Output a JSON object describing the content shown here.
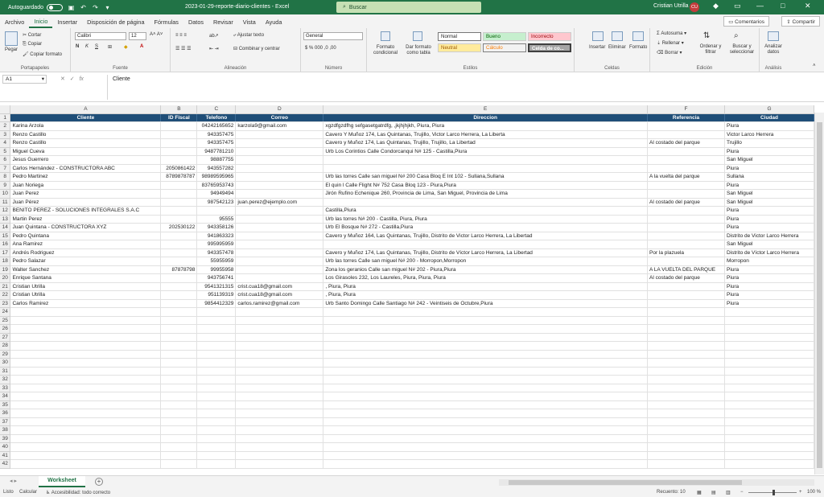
{
  "titlebar": {
    "autosave_label": "Autoguardado",
    "document_title": "2023-01-29-reporte-diario-clientes - Excel",
    "search_placeholder": "Buscar",
    "user_name": "Cristian Utrilla",
    "user_initials": "CU"
  },
  "menu": {
    "tabs": [
      "Archivo",
      "Inicio",
      "Insertar",
      "Disposición de página",
      "Fórmulas",
      "Datos",
      "Revisar",
      "Vista",
      "Ayuda"
    ],
    "active": "Inicio",
    "comments_label": "Comentarios",
    "share_label": "Compartir"
  },
  "ribbon": {
    "clipboard": {
      "paste": "Pegar",
      "cut": "Cortar",
      "copy": "Copiar",
      "format_painter": "Copiar formato",
      "label": "Portapapeles"
    },
    "font": {
      "name": "Calibri",
      "size": "12",
      "label": "Fuente"
    },
    "alignment": {
      "wrap": "Ajustar texto",
      "merge": "Combinar y centrar",
      "label": "Alineación"
    },
    "number": {
      "format": "General",
      "label": "Número"
    },
    "styles": {
      "conditional": "Formato condicional",
      "as_table": "Dar formato como tabla",
      "normal": "Normal",
      "good": "Bueno",
      "bad": "Incorrecto",
      "neutral": "Neutral",
      "calc": "Cálculo",
      "check": "Celda de co...",
      "label": "Estilos"
    },
    "cells": {
      "insert": "Insertar",
      "delete": "Eliminar",
      "format": "Formato",
      "label": "Celdas"
    },
    "editing": {
      "autosum": "Autosuma",
      "fill": "Rellenar",
      "clear": "Borrar",
      "sort": "Ordenar y filtrar",
      "find": "Buscar y seleccionar",
      "label": "Edición"
    },
    "analysis": {
      "analyze": "Analizar datos",
      "label": "Análisis"
    }
  },
  "formula_bar": {
    "name_box": "A1",
    "content": "Cliente"
  },
  "sheet": {
    "columns": [
      "A",
      "B",
      "C",
      "D",
      "E",
      "F",
      "G"
    ],
    "headers": [
      "Cliente",
      "ID Fiscal",
      "Telefono",
      "Correo",
      "Direccion",
      "Referencia",
      "Ciudad"
    ],
    "rows": [
      [
        "Karina Arzola",
        "",
        "04242165652",
        "karzola9@gmail.com",
        " xgzdfgzdfhg sefgasetgatrdfg, ,jkjhjhjkh, Piura, Piura",
        "",
        "Piura"
      ],
      [
        "Renzo  Castillo",
        "",
        "943357475",
        "",
        "Cavero Y Muñoz 174, Las Quintanas, Trujillo, Victor Larco Herrera, La Liberta",
        "",
        "Victor Larco Herrera"
      ],
      [
        "Renzo Castillo",
        "",
        "943357475",
        "",
        "Cavero y Muñoz 174, Las Quintanas, Trujillo, Trujillo, La Libertad",
        "Al costado del parque",
        "Trujillo"
      ],
      [
        "Miguel Cueva",
        "",
        "9487781210",
        "",
        "Urb Los Corintios Calle Condorcanqui N# 125 - Castilla,Piura",
        "",
        "Piura"
      ],
      [
        "Jesus Guerrero",
        "",
        "98887755",
        "",
        "",
        "",
        "San Miguel"
      ],
      [
        "Carlos Hernández - CONSTRUCTORA ABC",
        "2050861422",
        "943557282",
        "",
        "",
        "",
        "Piura"
      ],
      [
        "Pedro Martinez",
        "8789878787",
        "98989595965",
        "",
        "Urb las torres Calle san miguel N# 200 Casa Bloq E Int 102 - Sullana,Sullana",
        "A la vuelta del parque",
        "Sullana"
      ],
      [
        "Juan Noriega",
        "",
        "83765953743",
        "",
        "El quin l Calle Flight N# 752 Casa Bloq 123 - Piura,Piura",
        "",
        "Piura"
      ],
      [
        "Juan  Perez",
        "",
        "94949494",
        "",
        "Jirón Rufino Echenique 260, Provincia de Lima, San Miguel, Provincia de Lima",
        "",
        "San Miguel"
      ],
      [
        "Juan Pérez",
        "",
        "987542123",
        "juan.perez@ejemplo.com",
        "",
        "Al costado del parque",
        "San Miguel"
      ],
      [
        "BENITO PEREZ - SOLUCIONES INTEGRALES S.A.C",
        "",
        "",
        "",
        "Castilla,Piura",
        "",
        "Piura"
      ],
      [
        "Martin Perez",
        "",
        "95555",
        "",
        "Urb las torres N# 200 - Castilla, Piura, Piura",
        "",
        "Piura"
      ],
      [
        "Juan Quintana - CONSTRUCTORA XYZ",
        "202530122",
        "943358126",
        "",
        "Urb El Bosque N# 272 - Castilla,Piura",
        "",
        "Piura"
      ],
      [
        "Pedro  Quintana",
        "",
        "941863323",
        "",
        "Cavero y Muñoz 164, Las Quintanas, Trujillo, Distrito de Victor Larco Herrera, La Libertad",
        "",
        "Distrito de Victor Larco Herrera"
      ],
      [
        "Ana Ramirez",
        "",
        "995995959",
        "",
        "",
        "",
        "San Miguel"
      ],
      [
        "Andrés Rodriguez",
        "",
        "943357478",
        "",
        " Cavero y Muñoz 174, Las Quintanas, Trujillo, Distrito de Víctor Larco Herrera, La Libertad",
        "Por la plazuela",
        "Distrito de Víctor Larco Herrera"
      ],
      [
        "Pedro Salazar",
        "",
        "55955959",
        "",
        "Urb las torres Calle san miguel N# 200 - Morropon,Morropon",
        "",
        "Morropon"
      ],
      [
        "Walter Sanchez",
        "87878798",
        "99955958",
        "",
        "Zona los geranios Calle san miguel N# 202 - Piura,Piura",
        "A LA VUELTA DEL PARQUE",
        "Piura"
      ],
      [
        "Enrique Santana",
        "",
        "943756741",
        "",
        " Los Girasoles 232, Los Laureles, Piura, Piura, Piura",
        "Al costado del parque",
        "Piura"
      ],
      [
        "Cristian Utrilla",
        "",
        "9541321315",
        "crist.cua18@gmail.com",
        ", Piura, Piura",
        "",
        "Piura"
      ],
      [
        "Cristian Utrilla",
        "",
        "951139319",
        "crist.cua18@gmail.com",
        ", Piura, Piura",
        "",
        "Piura"
      ],
      [
        "Carlos Ramirez",
        "",
        "9854412329",
        "carlos.ramirez@gmail.com",
        "Urb Santo Domingo Calle Santiago N# 242 - Veintiseis de Octubre,Piura",
        "",
        "Piura"
      ]
    ],
    "total_rows": 42
  },
  "sheet_tabs": {
    "active": "Worksheet"
  },
  "status": {
    "ready": "Listo",
    "calc": "Calcular",
    "accessibility": "Accesibilidad: todo correcto",
    "count": "Recuento: 10",
    "zoom": "100 %"
  }
}
